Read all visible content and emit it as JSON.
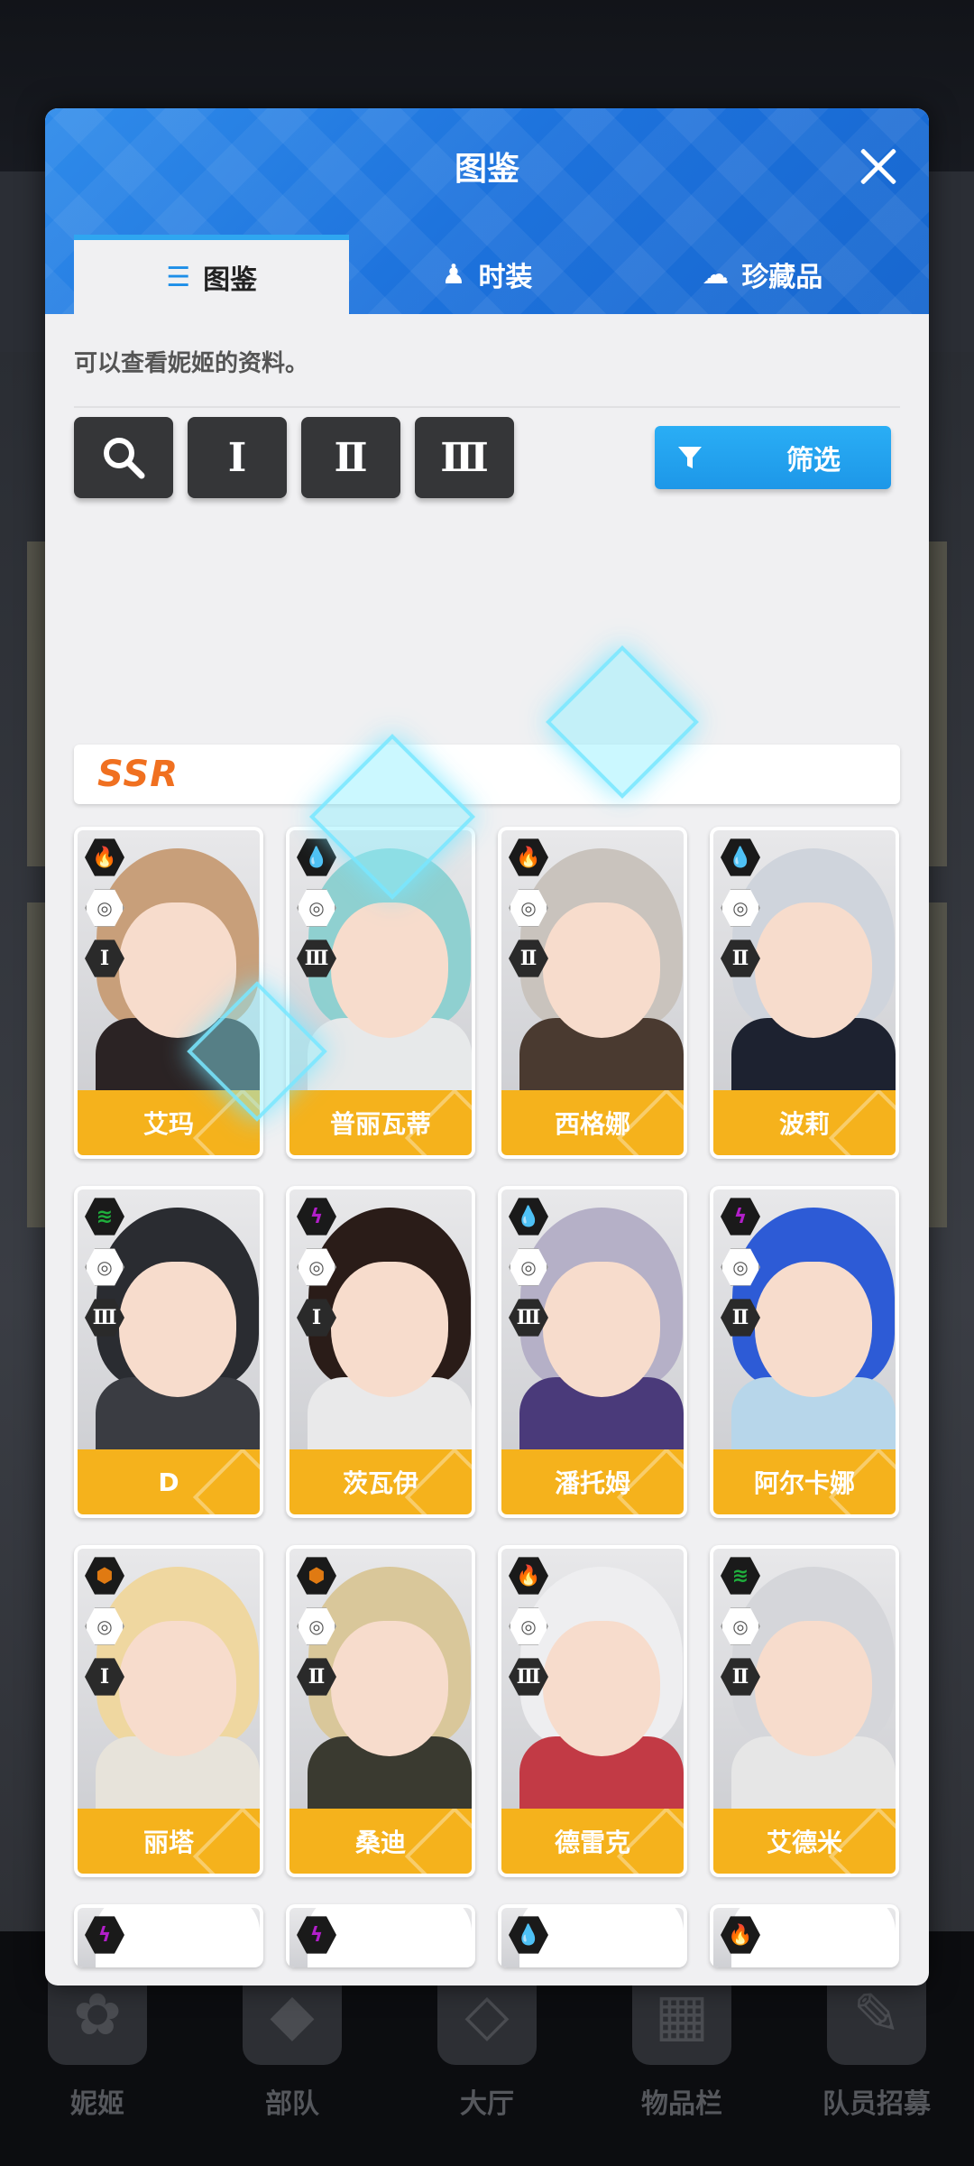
{
  "modal": {
    "title": "图鉴",
    "tabs": [
      {
        "label": "图鉴",
        "icon": "list-icon",
        "active": true
      },
      {
        "label": "时装",
        "icon": "dress-icon",
        "active": false
      },
      {
        "label": "珍藏品",
        "icon": "collection-icon",
        "active": false
      }
    ],
    "description": "可以查看妮姬的资料。",
    "tools": {
      "search_icon": "search-icon",
      "burst_1": "Ⅰ",
      "burst_2": "Ⅱ",
      "burst_3": "Ⅲ",
      "filter_label": "筛选"
    },
    "rarity_header": "SSR"
  },
  "characters": [
    {
      "name": "艾玛",
      "element": "fire",
      "element_color": "#d0202b",
      "burst": "Ⅰ",
      "hair": "#c89f7a",
      "outfit": "#2b2324"
    },
    {
      "name": "普丽瓦蒂",
      "element": "water",
      "element_color": "#1668d8",
      "burst": "Ⅲ",
      "hair": "#8fd0d0",
      "outfit": "#e7e9ea"
    },
    {
      "name": "西格娜",
      "element": "fire",
      "element_color": "#d0202b",
      "burst": "Ⅱ",
      "hair": "#c9c3bd",
      "outfit": "#4a3a30"
    },
    {
      "name": "波莉",
      "element": "water",
      "element_color": "#1668d8",
      "burst": "Ⅱ",
      "hair": "#cfd4dc",
      "outfit": "#1d2230"
    },
    {
      "name": "D",
      "element": "wind",
      "element_color": "#1fae3c",
      "burst": "Ⅲ",
      "hair": "#2a2c31",
      "outfit": "#3a3c42"
    },
    {
      "name": "茨瓦伊",
      "element": "electric",
      "element_color": "#b21fc9",
      "burst": "Ⅰ",
      "hair": "#2a1c18",
      "outfit": "#e9e9ea"
    },
    {
      "name": "潘托姆",
      "element": "water",
      "element_color": "#1668d8",
      "burst": "Ⅲ",
      "hair": "#b5b0c7",
      "outfit": "#4a3a7a"
    },
    {
      "name": "阿尔卡娜",
      "element": "electric",
      "element_color": "#b21fc9",
      "burst": "Ⅱ",
      "hair": "#2d5bd6",
      "outfit": "#b7d6ea"
    },
    {
      "name": "丽塔",
      "element": "iron",
      "element_color": "#e07a12",
      "burst": "Ⅰ",
      "hair": "#efd7a0",
      "outfit": "#e7e3da"
    },
    {
      "name": "桑迪",
      "element": "iron",
      "element_color": "#e07a12",
      "burst": "Ⅱ",
      "hair": "#d9c79a",
      "outfit": "#3a3a30"
    },
    {
      "name": "德雷克",
      "element": "fire",
      "element_color": "#d0202b",
      "burst": "Ⅲ",
      "hair": "#eeeef0",
      "outfit": "#c23a45"
    },
    {
      "name": "艾德米",
      "element": "wind",
      "element_color": "#1fae3c",
      "burst": "Ⅱ",
      "hair": "#d5d6da",
      "outfit": "#e6e6e6"
    },
    {
      "name": "",
      "element": "electric",
      "element_color": "#b21fc9",
      "burst": "",
      "hair": "#f0e090",
      "outfit": "#ffffff"
    },
    {
      "name": "",
      "element": "electric",
      "element_color": "#b21fc9",
      "burst": "",
      "hair": "#e9e2cf",
      "outfit": "#ffffff"
    },
    {
      "name": "",
      "element": "water",
      "element_color": "#1668d8",
      "burst": "",
      "hair": "#5a2a4a",
      "outfit": "#ffffff"
    },
    {
      "name": "",
      "element": "fire",
      "element_color": "#d0202b",
      "burst": "",
      "hair": "#3a2a30",
      "outfit": "#ffffff"
    }
  ],
  "bottom_nav": [
    {
      "label": "妮姬",
      "icon": "nikke-icon"
    },
    {
      "label": "部队",
      "icon": "squad-icon"
    },
    {
      "label": "大厅",
      "icon": "lobby-icon"
    },
    {
      "label": "物品栏",
      "icon": "inventory-icon"
    },
    {
      "label": "队员招募",
      "icon": "recruit-icon"
    }
  ]
}
